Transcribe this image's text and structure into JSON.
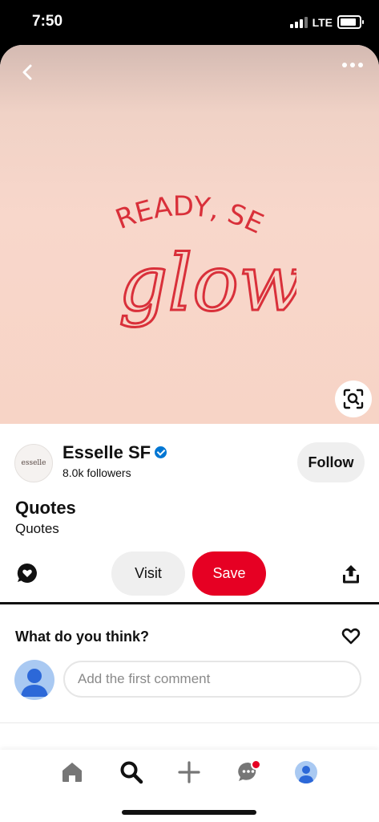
{
  "status_bar": {
    "time": "7:50",
    "network": "LTE"
  },
  "pin": {
    "image_text": {
      "line1": "READY, SET",
      "line2": "glow"
    },
    "title": "Quotes",
    "description": "Quotes"
  },
  "creator": {
    "avatar_text": "esselle",
    "name": "Esselle SF",
    "followers": "8.0k followers",
    "follow_label": "Follow"
  },
  "actions": {
    "visit_label": "Visit",
    "save_label": "Save"
  },
  "comments": {
    "heading": "What do you think?",
    "placeholder": "Add the first comment"
  },
  "tab_bar": {
    "items": [
      {
        "name": "home",
        "icon": "home-icon"
      },
      {
        "name": "search",
        "icon": "search-icon",
        "active": true
      },
      {
        "name": "create",
        "icon": "plus-icon"
      },
      {
        "name": "messages",
        "icon": "chat-icon",
        "has_notification": true
      },
      {
        "name": "profile",
        "icon": "avatar-icon"
      }
    ]
  },
  "colors": {
    "save_red": "#e60023",
    "verified_blue": "#0076d3",
    "hero_pink": "#f8d7cb",
    "lettering_red": "#d9303a"
  }
}
